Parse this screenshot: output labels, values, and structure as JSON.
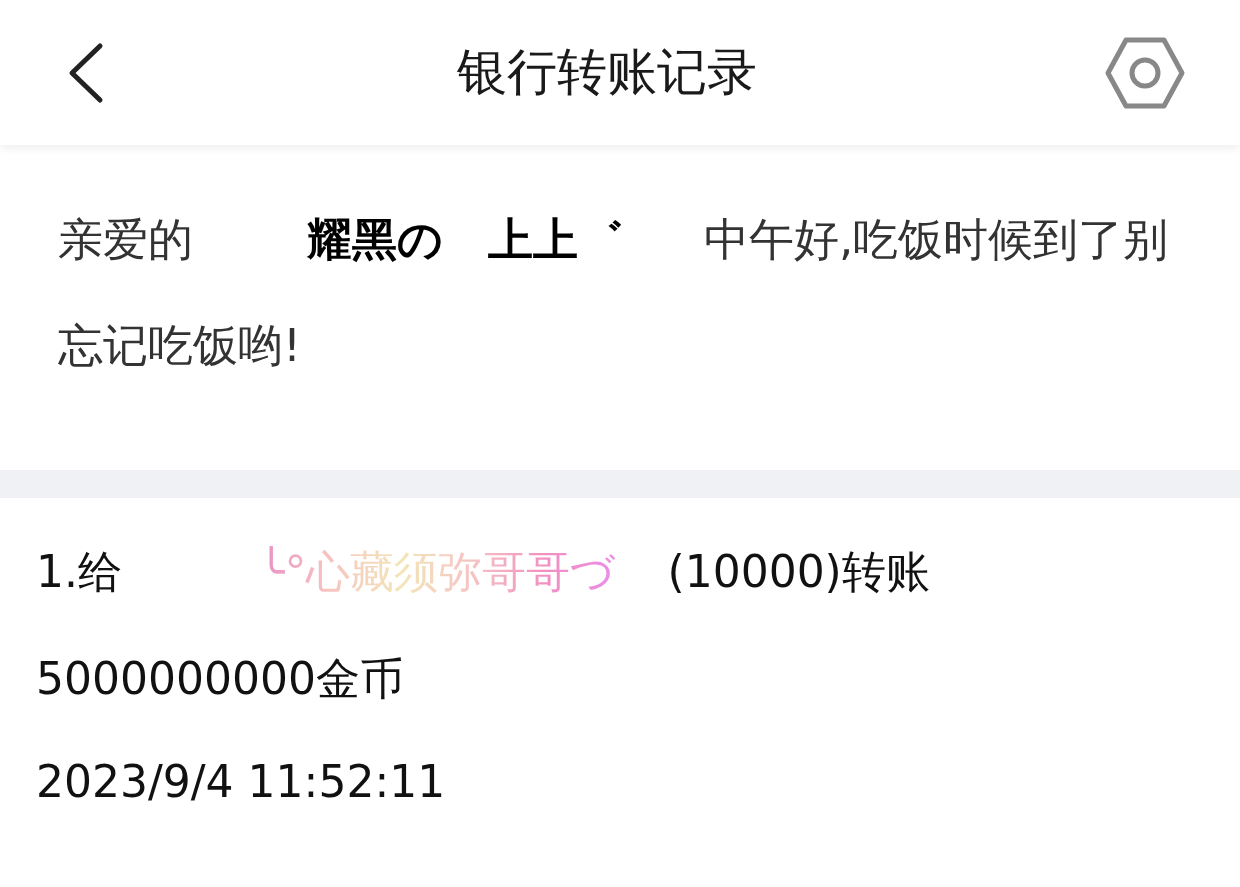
{
  "header": {
    "title": "银行转账记录"
  },
  "greeting": {
    "salutation": "亲爱的",
    "nickname": "耀黑の　上上゛",
    "message": "中午好,吃饭时候到了别忘记吃饭哟!"
  },
  "records": [
    {
      "index": "1.给",
      "recipient": "╰°心藏须弥哥哥づ",
      "amount": "(10000)转账5000000000金币",
      "time": "2023/9/4 11:52:11"
    }
  ]
}
